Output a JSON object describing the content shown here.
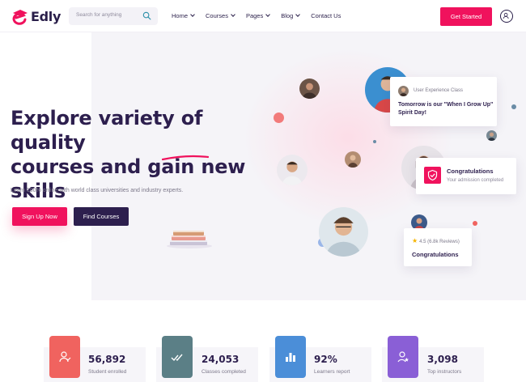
{
  "brand": {
    "name": "Edly",
    "color": "#f0125d",
    "dark": "#2d1f4e"
  },
  "search": {
    "placeholder": "Search for anything",
    "icon": "search-icon"
  },
  "nav": [
    {
      "label": "Home",
      "dropdown": true
    },
    {
      "label": "Courses",
      "dropdown": true
    },
    {
      "label": "Pages",
      "dropdown": true
    },
    {
      "label": "Blog",
      "dropdown": true
    },
    {
      "label": "Contact Us",
      "dropdown": false
    }
  ],
  "header": {
    "cta_label": "Get Started",
    "user_icon": "user-icon"
  },
  "hero": {
    "title_line1": "Explore variety of quality",
    "title_line2a": "courses and gain ",
    "title_highlight": "new",
    "title_line3": "skills",
    "subtitle": "Learn 100% online with world class universities and industry experts.",
    "primary_label": "Sign Up Now",
    "secondary_label": "Find Courses"
  },
  "cards": {
    "class_tag": "User Experience Class",
    "class_message": "Tomorrow is our \"When I Grow Up\" Spirit Day!",
    "admission_title": "Congratulations",
    "admission_sub": "Your admission completed",
    "rating": "4.5 (6.8k Reviews)",
    "rating_title": "Congratulations"
  },
  "stats": [
    {
      "value": "56,892",
      "label": "Student enrolled",
      "color": "#f0635f",
      "icon": "student-icon"
    },
    {
      "value": "24,053",
      "label": "Classes completed",
      "color": "#5b7f86",
      "icon": "check-icon"
    },
    {
      "value": "92%",
      "label": "Learners report",
      "color": "#4b8ed8",
      "icon": "chart-icon"
    },
    {
      "value": "3,098",
      "label": "Top instructors",
      "color": "#8a5fd6",
      "icon": "instructor-icon"
    }
  ]
}
